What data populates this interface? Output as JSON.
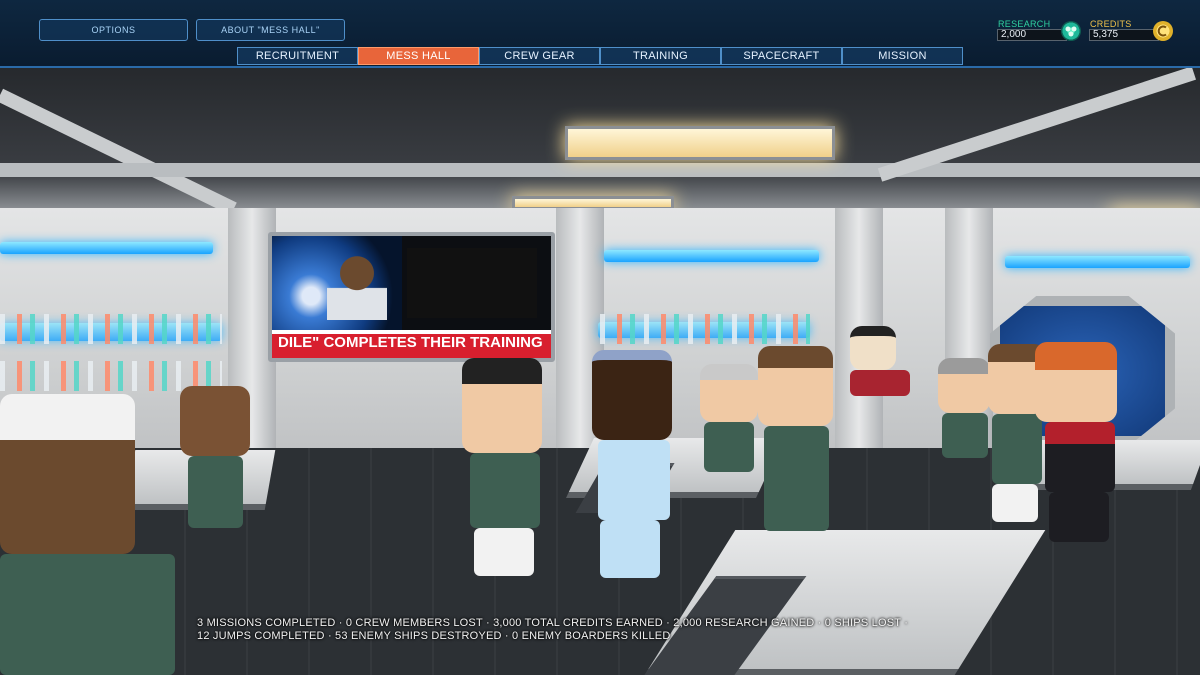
{
  "header": {
    "options_label": "OPTIONS",
    "about_label": "ABOUT \"MESS HALL\""
  },
  "tabs": [
    {
      "label": "RECRUITMENT",
      "active": false
    },
    {
      "label": "MESS HALL",
      "active": true
    },
    {
      "label": "CREW GEAR",
      "active": false
    },
    {
      "label": "TRAINING",
      "active": false
    },
    {
      "label": "SPACECRAFT",
      "active": false
    },
    {
      "label": "MISSION",
      "active": false
    }
  ],
  "resources": {
    "research": {
      "label": "RESEARCH",
      "value": "2,000",
      "icon": "research-atom-icon",
      "color": "#1fb89a"
    },
    "credits": {
      "label": "CREDITS",
      "value": "5,375",
      "icon": "credits-coin-icon",
      "color": "#e0b12a"
    }
  },
  "tv": {
    "ticker": "DILE\" COMPLETES THEIR TRAINING"
  },
  "stats": {
    "line1": "3 MISSIONS COMPLETED · 0 CREW MEMBERS LOST · 3,000 TOTAL CREDITS EARNED · 2,000 RESEARCH GAINED · 0 SHIPS LOST ·",
    "line2": "12 JUMPS COMPLETED · 53 ENEMY SHIPS DESTROYED · 0 ENEMY BOARDERS KILLED"
  },
  "colors": {
    "accent": "#e8653a",
    "hud_border": "#4f8fc9",
    "hud_bg": "#0e2740"
  }
}
